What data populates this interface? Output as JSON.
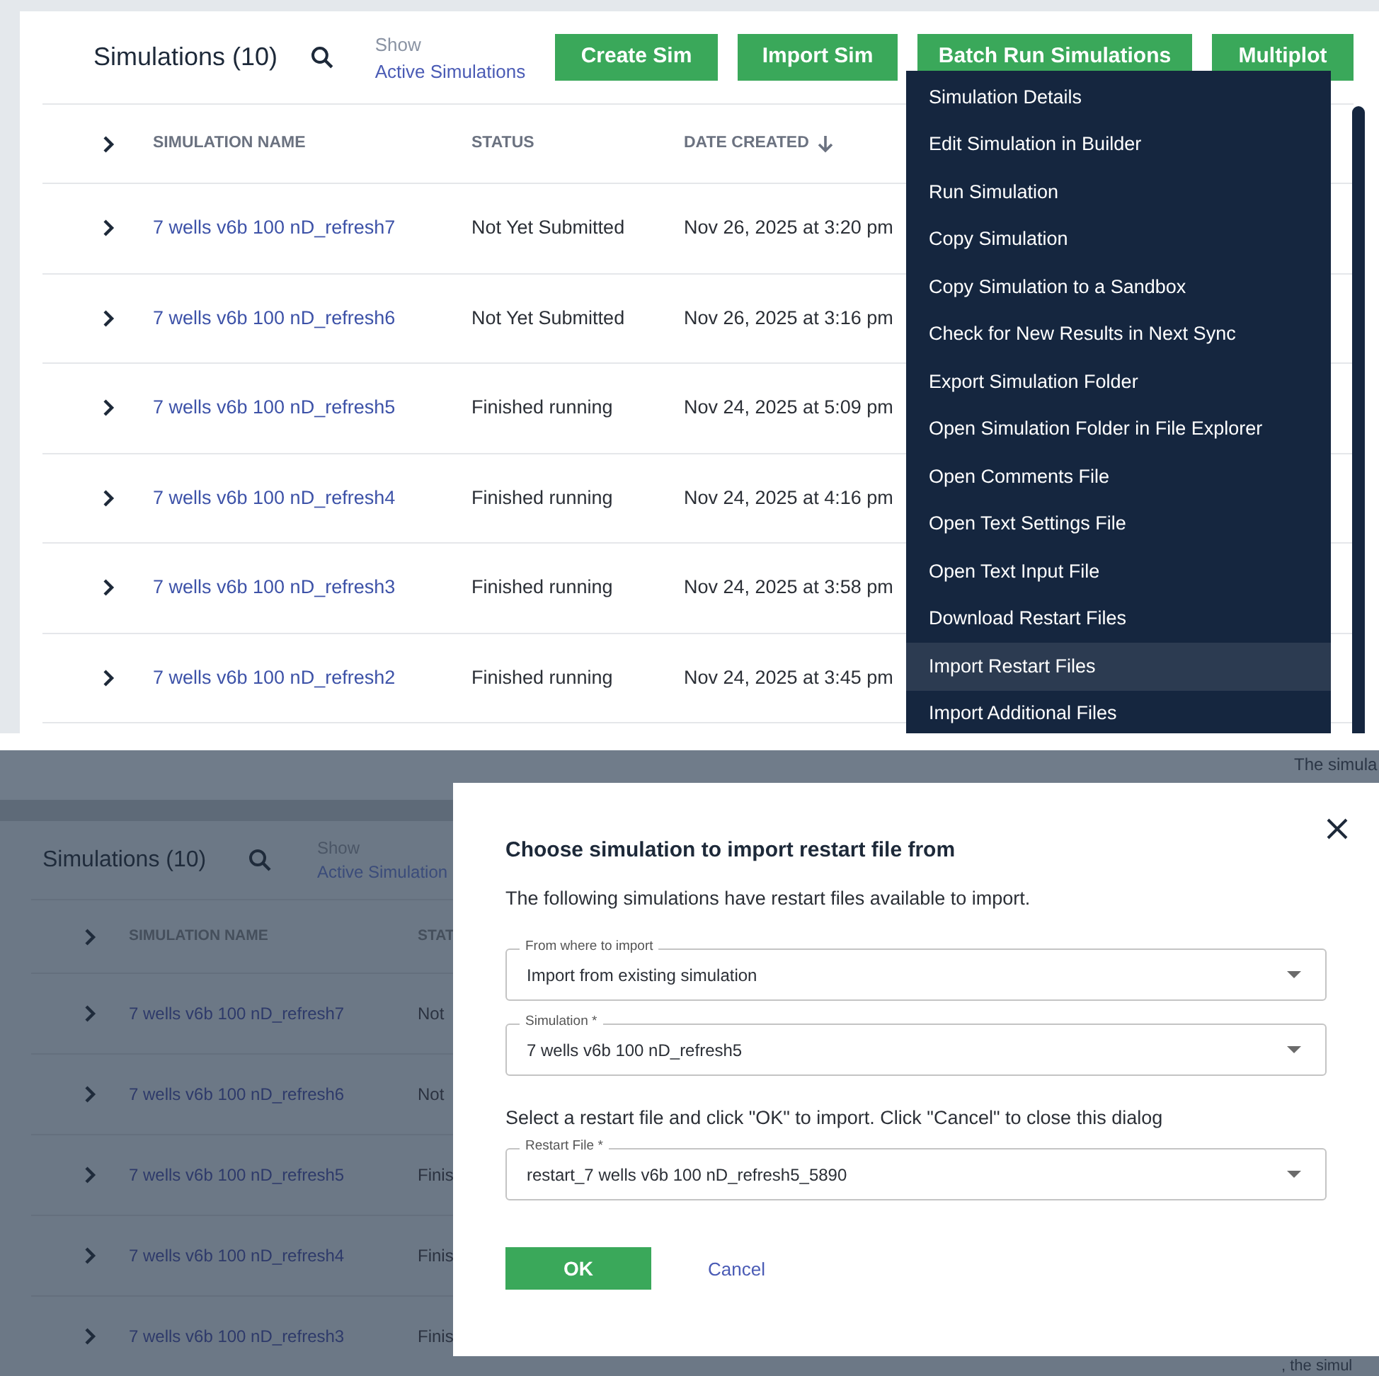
{
  "top_view": {
    "title": "Simulations (10)",
    "show_label": "Show",
    "show_link": "Active Simulations",
    "buttons": [
      "Create Sim",
      "Import Sim",
      "Batch Run Simulations",
      "Multiplot"
    ],
    "columns": [
      {
        "label": "SIMULATION NAME",
        "sorted": false
      },
      {
        "label": "STATUS",
        "sorted": false
      },
      {
        "label": "DATE CREATED",
        "sorted": true
      }
    ],
    "rows": [
      {
        "name": "7 wells v6b 100 nD_refresh7",
        "status": "Not Yet Submitted",
        "date": "Nov 26, 2025 at 3:20 pm"
      },
      {
        "name": "7 wells v6b 100 nD_refresh6",
        "status": "Not Yet Submitted",
        "date": "Nov 26, 2025 at 3:16 pm"
      },
      {
        "name": "7 wells v6b 100 nD_refresh5",
        "status": "Finished running",
        "date": "Nov 24, 2025 at 5:09 pm"
      },
      {
        "name": "7 wells v6b 100 nD_refresh4",
        "status": "Finished running",
        "date": "Nov 24, 2025 at 4:16 pm"
      },
      {
        "name": "7 wells v6b 100 nD_refresh3",
        "status": "Finished running",
        "date": "Nov 24, 2025 at 3:58 pm"
      },
      {
        "name": "7 wells v6b 100 nD_refresh2",
        "status": "Finished running",
        "date": "Nov 24, 2025 at 3:45 pm"
      }
    ],
    "context_menu": [
      {
        "label": "Simulation Details",
        "selected": false
      },
      {
        "label": "Edit Simulation in Builder",
        "selected": false
      },
      {
        "label": "Run Simulation",
        "selected": false
      },
      {
        "label": "Copy Simulation",
        "selected": false
      },
      {
        "label": "Copy Simulation to a Sandbox",
        "selected": false
      },
      {
        "label": "Check for New Results in Next Sync",
        "selected": false
      },
      {
        "label": "Export Simulation Folder",
        "selected": false
      },
      {
        "label": "Open Simulation Folder in File Explorer",
        "selected": false
      },
      {
        "label": "Open Comments File",
        "selected": false
      },
      {
        "label": "Open Text Settings File",
        "selected": false
      },
      {
        "label": "Open Text Input File",
        "selected": false
      },
      {
        "label": "Download Restart Files",
        "selected": false
      },
      {
        "label": "Import Restart Files",
        "selected": true
      },
      {
        "label": "Import Additional Files",
        "selected": false
      }
    ]
  },
  "bottom_view": {
    "title": "Simulations (10)",
    "show_label": "Show",
    "show_link": "Active Simulation",
    "columns": [
      "SIMULATION NAME",
      "STAT"
    ],
    "rows": [
      {
        "name": "7 wells v6b 100 nD_refresh7",
        "status": "Not"
      },
      {
        "name": "7 wells v6b 100 nD_refresh6",
        "status": "Not"
      },
      {
        "name": "7 wells v6b 100 nD_refresh5",
        "status": "Finis"
      },
      {
        "name": "7 wells v6b 100 nD_refresh4",
        "status": "Finis"
      },
      {
        "name": "7 wells v6b 100 nD_refresh3",
        "status": "Finis"
      }
    ],
    "side_text_top": "The simula",
    "side_text_bottom": ", the simul",
    "dialog": {
      "title": "Choose simulation to import restart file from",
      "description": "The following simulations have restart files available to import.",
      "items": [
        {
          "kind": "select",
          "label": "From where to import",
          "value": "Import from existing simulation"
        },
        {
          "kind": "select",
          "label": "Simulation *",
          "value": "7 wells v6b 100 nD_refresh5"
        },
        {
          "kind": "text",
          "text": "Select a restart file and click \"OK\" to import. Click \"Cancel\" to close this dialog"
        },
        {
          "kind": "select",
          "label": "Restart File *",
          "value": "restart_7 wells v6b 100 nD_refresh5_5890"
        }
      ],
      "ok": "OK",
      "cancel": "Cancel"
    }
  }
}
